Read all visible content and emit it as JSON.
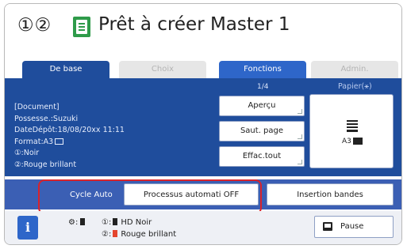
{
  "header": {
    "drum_numbers": "①②",
    "icon": "master-document-icon",
    "status_title": "Prêt à créer Master 1"
  },
  "tabs": [
    {
      "label": "De base",
      "state": "active"
    },
    {
      "label": "Choix",
      "state": "disabled"
    },
    {
      "label": "Fonctions",
      "state": "enabled"
    },
    {
      "label": "Admin.",
      "state": "disabled"
    }
  ],
  "document_info": {
    "line1": "[Document]",
    "line2": "Possesse.:Suzuki",
    "line3": "DateDépôt:18/08/20xx 11:11",
    "line4": "Format:A3",
    "line5": "①:Noir",
    "line6": "②:Rouge brillant"
  },
  "page_indicator": "1/4",
  "buttons": {
    "preview": "Aperçu",
    "skip_page": "Saut. page",
    "clear_all": "Effac.tout"
  },
  "paper": {
    "label": "Papier(⚹)",
    "size_label": "A3"
  },
  "cycle": {
    "label": "Cycle Auto",
    "auto_process": "Processus automati OFF",
    "insert_strips": "Insertion bandes"
  },
  "status_bar": {
    "info_label": "i",
    "drum1_label": "①:",
    "drum1_ink": "HD Noir",
    "drum2_label": "②:",
    "drum2_ink": "Rouge brillant",
    "pause_label": "Pause"
  },
  "colors": {
    "panel": "#1f4d9c",
    "tab_active": "#1f4d9c",
    "highlight": "#d9232b",
    "icon_green": "#2f9b4a",
    "ink_red": "#e4452e"
  }
}
